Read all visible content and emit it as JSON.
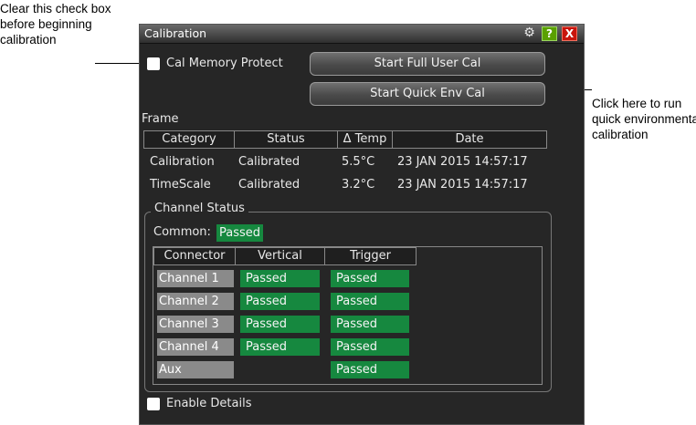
{
  "annotations": {
    "left_lines": [
      "Clear this check box",
      "before beginning",
      "calibration"
    ],
    "right_lines": [
      "Click here to run",
      "quick environmental",
      "calibration"
    ]
  },
  "window": {
    "title": "Calibration",
    "icons": {
      "settings": "gear-icon",
      "help": "help-icon",
      "close": "close-icon"
    },
    "help_glyph": "?",
    "close_glyph": "X"
  },
  "controls": {
    "cal_memory_protect_label": "Cal Memory Protect",
    "start_full_user_cal": "Start Full User Cal",
    "start_quick_env_cal": "Start Quick Env Cal"
  },
  "frame": {
    "label": "Frame",
    "columns": [
      "Category",
      "Status",
      "Δ Temp",
      "Date"
    ],
    "rows": [
      {
        "category": "Calibration",
        "status": "Calibrated",
        "delta_temp": "5.5°C",
        "date": "23 JAN 2015 14:57:17"
      },
      {
        "category": "TimeScale",
        "status": "Calibrated",
        "delta_temp": "3.2°C",
        "date": "23 JAN 2015 14:57:17"
      }
    ]
  },
  "channel_status": {
    "label": "Channel Status",
    "common_label": "Common:",
    "common_value": "Passed",
    "columns": [
      "Connector",
      "Vertical",
      "Trigger"
    ],
    "rows": [
      {
        "connector": "Channel 1",
        "vertical": "Passed",
        "trigger": "Passed"
      },
      {
        "connector": "Channel 2",
        "vertical": "Passed",
        "trigger": "Passed"
      },
      {
        "connector": "Channel 3",
        "vertical": "Passed",
        "trigger": "Passed"
      },
      {
        "connector": "Channel 4",
        "vertical": "Passed",
        "trigger": "Passed"
      },
      {
        "connector": "Aux",
        "vertical": "",
        "trigger": "Passed"
      }
    ]
  },
  "enable_details_label": "Enable Details",
  "colors": {
    "passed": "#16883f",
    "connector_bg": "#8a8a8a",
    "window_bg": "#262626",
    "close": "#c8140c",
    "help": "#5aa000"
  }
}
